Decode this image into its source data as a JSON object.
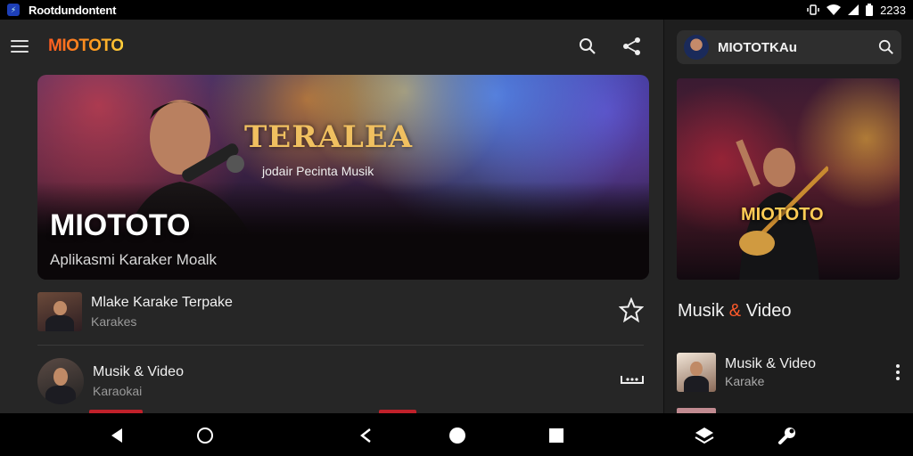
{
  "status_bar": {
    "app_title": "Rootdundontent",
    "time": "2233"
  },
  "topbar": {
    "brand": "MIOTOTO"
  },
  "hero": {
    "heading": "TERALEA",
    "tagline": "jodair Pecinta Musik",
    "title": "MIOTOTO",
    "subtitle": "Aplikasmi Karaker Moalk"
  },
  "list": [
    {
      "title": "Mlake Karake Terpake",
      "subtitle": "Karakes",
      "action_icon": "star-icon"
    },
    {
      "title": "Musik & Video",
      "subtitle": "Karaokai",
      "action_icon": "queue-icon"
    }
  ],
  "side": {
    "search_brand": "MIOTOTKAu",
    "hero_title": "MIOTOTO",
    "heading_part1": "Musik",
    "heading_amp": "&",
    "heading_part2": "Video",
    "item": {
      "title": "Musik & Video",
      "subtitle": "Karake"
    }
  },
  "colors": {
    "accent": "#ff5a2a",
    "background": "#262626",
    "side_background": "#1e1e1e"
  }
}
